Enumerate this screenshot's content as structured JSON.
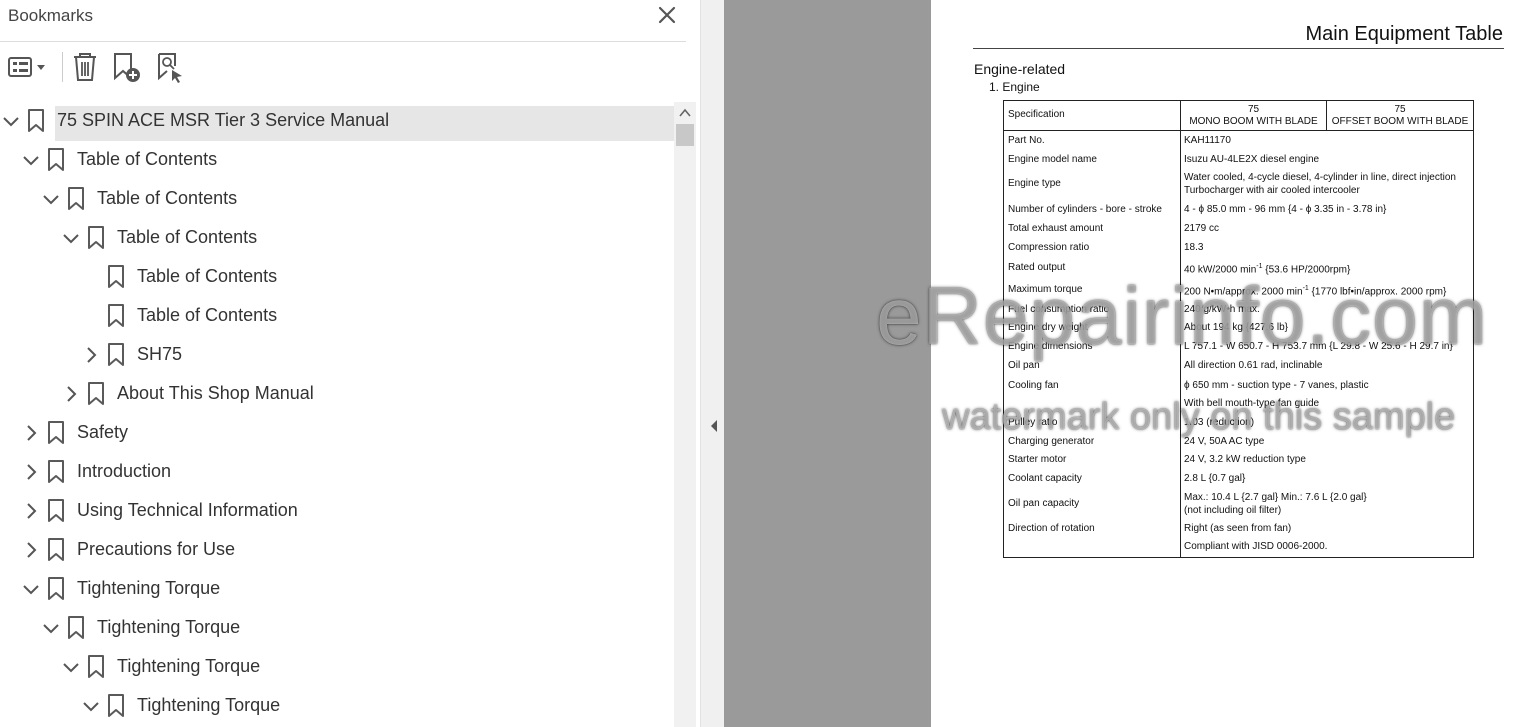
{
  "bookmarks_panel": {
    "title": "Bookmarks",
    "tree": [
      {
        "label": "75 SPIN ACE MSR Tier 3 Service Manual",
        "level": 0,
        "expanded": true,
        "has_children": true,
        "selected": true
      },
      {
        "label": "Table of Contents",
        "level": 1,
        "expanded": true,
        "has_children": true
      },
      {
        "label": "Table of Contents",
        "level": 2,
        "expanded": true,
        "has_children": true
      },
      {
        "label": "Table of Contents",
        "level": 3,
        "expanded": true,
        "has_children": true
      },
      {
        "label": "Table of Contents",
        "level": 4,
        "has_children": false
      },
      {
        "label": "Table of Contents",
        "level": 4,
        "has_children": false
      },
      {
        "label": "SH75",
        "level": 4,
        "expanded": false,
        "has_children": true
      },
      {
        "label": "About This Shop Manual",
        "level": 3,
        "expanded": false,
        "has_children": true
      },
      {
        "label": "Safety",
        "level": 1,
        "expanded": false,
        "has_children": true
      },
      {
        "label": "Introduction",
        "level": 1,
        "expanded": false,
        "has_children": true
      },
      {
        "label": "Using Technical Information",
        "level": 1,
        "expanded": false,
        "has_children": true
      },
      {
        "label": "Precautions for Use",
        "level": 1,
        "expanded": false,
        "has_children": true
      },
      {
        "label": "Tightening Torque",
        "level": 1,
        "expanded": true,
        "has_children": true
      },
      {
        "label": "Tightening Torque",
        "level": 2,
        "expanded": true,
        "has_children": true
      },
      {
        "label": "Tightening Torque",
        "level": 3,
        "expanded": true,
        "has_children": true
      },
      {
        "label": "Tightening Torque",
        "level": 4,
        "expanded": true,
        "has_children": true
      }
    ]
  },
  "document": {
    "title": "Main Equipment Table",
    "section": "Engine-related",
    "subsection": "1. Engine",
    "table": {
      "header": {
        "spec": "Specification",
        "col1_top": "75",
        "col1_bottom": "MONO BOOM WITH BLADE",
        "col2_top": "75",
        "col2_bottom": "OFFSET BOOM WITH BLADE"
      },
      "rows": [
        {
          "label": "Part No.",
          "value": [
            "KAH11170"
          ]
        },
        {
          "label": "Engine model name",
          "value": [
            "Isuzu AU-4LE2X diesel engine"
          ]
        },
        {
          "label": "Engine type",
          "value": [
            "Water cooled, 4-cycle diesel, 4-cylinder in line, direct injection",
            "Turbocharger with air cooled intercooler"
          ]
        },
        {
          "label": "Number of cylinders - bore - stroke",
          "value": [
            "4 - ϕ 85.0 mm - 96 mm {4 - ϕ 3.35 in - 3.78 in}"
          ]
        },
        {
          "label": "Total exhaust amount",
          "value": [
            "2179 cc"
          ]
        },
        {
          "label": "Compression ratio",
          "value": [
            "18.3"
          ]
        },
        {
          "label": "Rated output",
          "value": [
            "40 kW/2000 min",
            "-1",
            " {53.6 HP/2000rpm}"
          ]
        },
        {
          "label": "Maximum torque",
          "value": [
            "200 N•m/approx. 2000 min",
            "-1",
            " {1770 lbf•in/approx. 2000 rpm}"
          ]
        },
        {
          "label": "Fuel consumption ratio",
          "value": [
            "240 g/kW•h max."
          ]
        },
        {
          "label": "Engine dry weight",
          "value": [
            "About 194 kg {427.6 lb}"
          ]
        },
        {
          "label": "Engine dimensions",
          "value": [
            "L 757.1 - W 650.7 - H 753.7 mm {L 29.8 - W 25.6 - H 29.7 in}"
          ]
        },
        {
          "label": "Oil pan",
          "value": [
            "All direction 0.61 rad, inclinable"
          ]
        },
        {
          "label": "Cooling fan",
          "value": [
            "ϕ 650 mm - suction type - 7 vanes, plastic",
            "With bell mouth-type fan guide"
          ]
        },
        {
          "label": "Pulley ratio",
          "value": [
            "1.03 (reduction)"
          ]
        },
        {
          "label": "Charging generator",
          "value": [
            "24 V, 50A AC type"
          ]
        },
        {
          "label": "Starter motor",
          "value": [
            "24 V, 3.2 kW reduction type"
          ]
        },
        {
          "label": "Coolant capacity",
          "value": [
            "2.8 L {0.7 gal}"
          ]
        },
        {
          "label": "Oil pan capacity",
          "value": [
            "Max.: 10.4 L {2.7 gal} Min.: 7.6 L {2.0 gal}",
            "(not including oil filter)"
          ]
        },
        {
          "label": "Direction of rotation",
          "value": [
            "Right (as seen from fan)"
          ]
        },
        {
          "label": "",
          "value": [
            "Compliant with JISD 0006-2000."
          ]
        }
      ]
    },
    "watermark": {
      "main": "eRepairinfo.com",
      "sub": "watermark only on this sample"
    }
  },
  "colors": {
    "gutter": "#9a9a9a",
    "selection": "#e6e6e6",
    "icon": "#5a5a5a"
  }
}
